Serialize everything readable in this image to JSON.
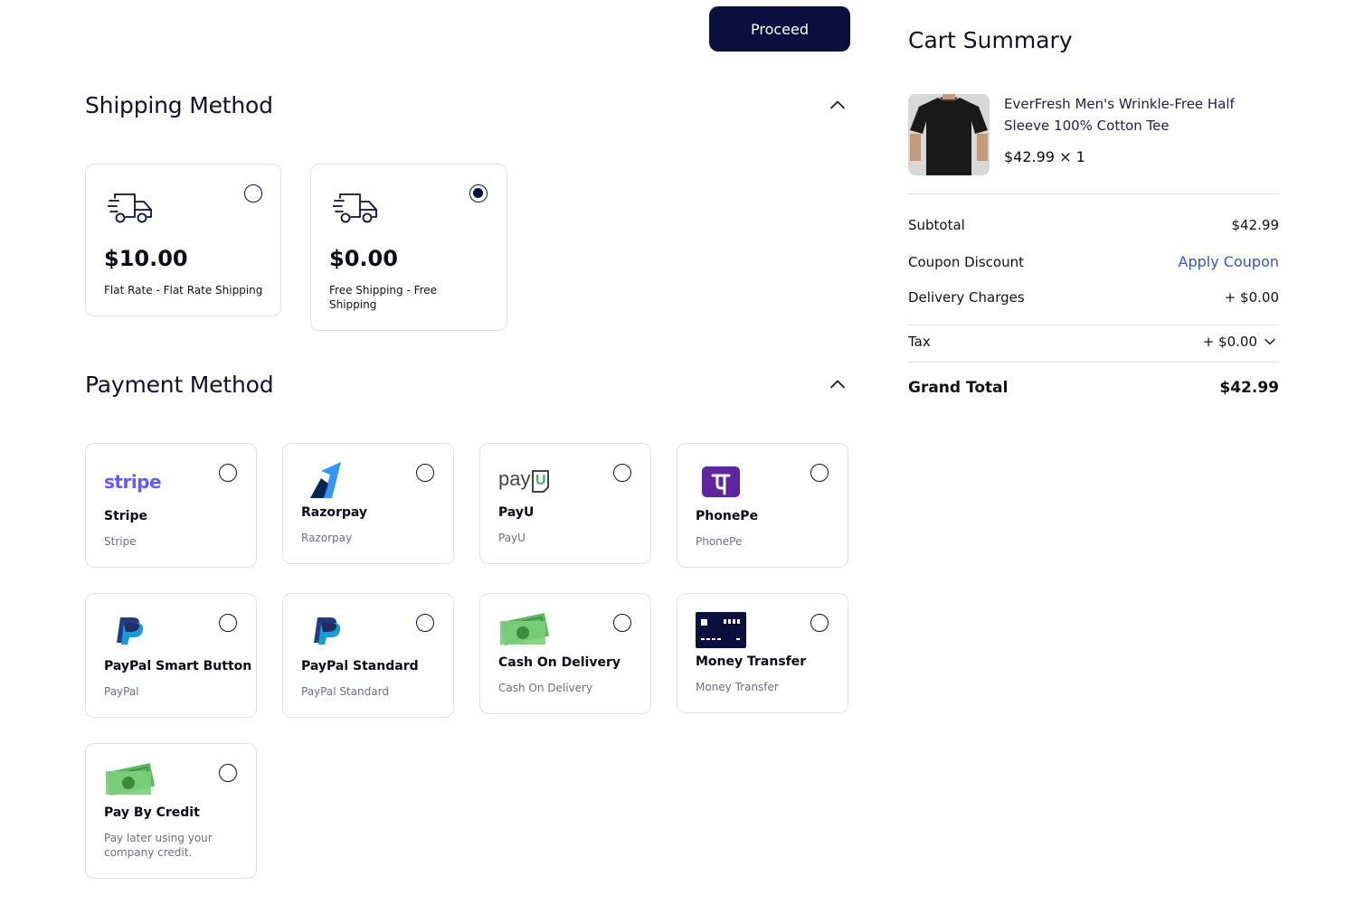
{
  "actions": {
    "proceed_label": "Proceed"
  },
  "shipping": {
    "title": "Shipping Method",
    "options": [
      {
        "price": "$10.00",
        "label": "Flat Rate - Flat Rate Shipping",
        "selected": false
      },
      {
        "price": "$0.00",
        "label": "Free Shipping - Free Shipping",
        "selected": true
      }
    ]
  },
  "payment": {
    "title": "Payment Method",
    "options": [
      {
        "name": "Stripe",
        "desc": "Stripe",
        "logo_text": "stripe",
        "icon": "stripe-logo"
      },
      {
        "name": "Razorpay",
        "desc": "Razorpay",
        "icon": "razorpay-logo"
      },
      {
        "name": "PayU",
        "desc": "PayU",
        "logo_text": "payU",
        "icon": "payu-logo"
      },
      {
        "name": "PhonePe",
        "desc": "PhonePe",
        "icon": "phonepe-logo"
      },
      {
        "name": "PayPal Smart Button",
        "desc": "PayPal",
        "icon": "paypal-logo"
      },
      {
        "name": "PayPal Standard",
        "desc": "PayPal Standard",
        "icon": "paypal-logo"
      },
      {
        "name": "Cash On Delivery",
        "desc": "Cash On Delivery",
        "icon": "cash-icon"
      },
      {
        "name": "Money Transfer",
        "desc": "Money Transfer",
        "icon": "card-icon"
      },
      {
        "name": "Pay By Credit",
        "desc": "Pay later using your company credit.",
        "icon": "cash-icon"
      }
    ]
  },
  "summary": {
    "title": "Cart Summary",
    "product": {
      "name": "EverFresh Men's Wrinkle-Free Half Sleeve 100% Cotton Tee",
      "price_qty": "$42.99 × 1"
    },
    "subtotal_label": "Subtotal",
    "subtotal": "$42.99",
    "coupon_label": "Coupon Discount",
    "coupon_action": "Apply Coupon",
    "delivery_label": "Delivery Charges",
    "delivery": "+ $0.00",
    "tax_label": "Tax",
    "tax": "+ $0.00",
    "grand_label": "Grand Total",
    "grand": "$42.99"
  },
  "colors": {
    "primary": "#0a0f3d",
    "link": "#3a4fd6",
    "border": "#dfe1e6",
    "muted": "#6b6f7a"
  }
}
